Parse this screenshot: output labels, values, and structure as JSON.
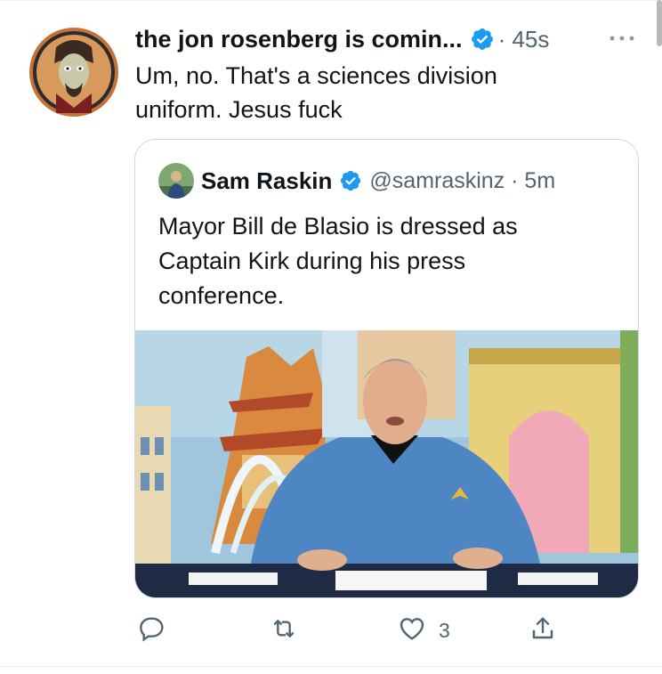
{
  "tweet": {
    "author_name": "the jon rosenberg is comin...",
    "meta": "· 45s",
    "text": "Um, no. That's a sciences division\nuniform. Jesus fuck",
    "more_icon": "more-horizontal-icon",
    "verified_icon": "verified-badge-icon"
  },
  "quoted": {
    "author_name": "Sam Raskin",
    "meta": "@samraskinz · 5m",
    "text": "Mayor Bill de Blasio is dressed as\nCaptain Kirk during his press\nconference."
  },
  "actions": {
    "reply_icon": "reply-icon",
    "retweet_icon": "retweet-icon",
    "like_icon": "like-heart-icon",
    "like_count": "3",
    "share_icon": "share-icon"
  },
  "colors": {
    "text": "#0f1419",
    "secondary": "#536471",
    "verified": "#1d9bf0",
    "border": "#cfd9de"
  }
}
